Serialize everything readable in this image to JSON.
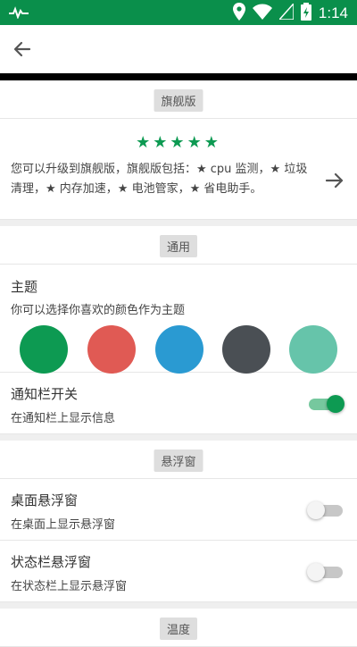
{
  "status_bar": {
    "time": "1:14"
  },
  "premium": {
    "section_label": "旗舰版",
    "stars": "★★★★★",
    "description": "您可以升级到旗舰版，旗舰版包括：★ cpu 监测，★ 垃圾清理，★ 内存加速，★ 电池管家，★ 省电助手。"
  },
  "general": {
    "section_label": "通用",
    "theme": {
      "title": "主题",
      "subtitle": "你可以选择你喜欢的颜色作为主题",
      "colors": [
        "#0d9a52",
        "#e05a54",
        "#2a9ad2",
        "#4a4f54",
        "#66c4aa"
      ]
    },
    "notification": {
      "title": "通知栏开关",
      "subtitle": "在通知栏上显示信息",
      "enabled": true
    }
  },
  "floating": {
    "section_label": "悬浮窗",
    "desktop": {
      "title": "桌面悬浮窗",
      "subtitle": "在桌面上显示悬浮窗",
      "enabled": false
    },
    "statusbar": {
      "title": "状态栏悬浮窗",
      "subtitle": "在状态栏上显示悬浮窗",
      "enabled": false
    }
  },
  "temperature": {
    "section_label": "温度"
  }
}
